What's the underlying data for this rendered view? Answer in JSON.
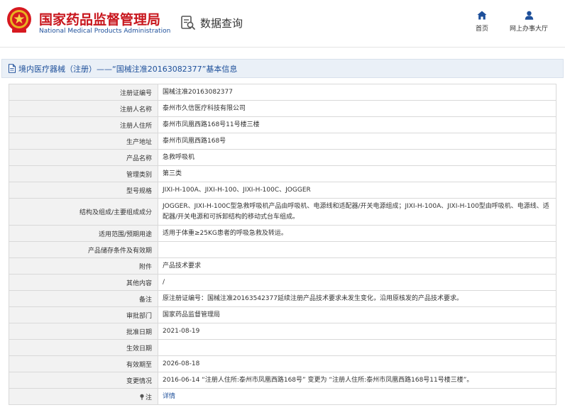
{
  "header": {
    "org_name_cn": "国家药品监督管理局",
    "org_name_en": "National Medical Products Administration",
    "query_label": "数据查询",
    "nav": [
      {
        "label": "首页",
        "icon": "home-icon"
      },
      {
        "label": "网上办事大厅",
        "icon": "user-icon"
      }
    ]
  },
  "title_bar": {
    "text": "境内医疗器械（注册）——“国械注准20163082377”基本信息",
    "icon": "document-icon"
  },
  "rows": [
    {
      "label": "注册证编号",
      "value": "国械注准20163082377"
    },
    {
      "label": "注册人名称",
      "value": "泰州市久信医疗科技有限公司"
    },
    {
      "label": "注册人住所",
      "value": "泰州市凤凰西路168号11号楼三楼"
    },
    {
      "label": "生产地址",
      "value": "泰州市凤凰西路168号"
    },
    {
      "label": "产品名称",
      "value": "急救呼吸机"
    },
    {
      "label": "管理类别",
      "value": "第三类"
    },
    {
      "label": "型号规格",
      "value": "JIXI-H-100A、JIXI-H-100、JIXI-H-100C、JOGGER"
    },
    {
      "label": "结构及组成/主要组成成分",
      "value": "JOGGER、JIXI-H-100C型急救呼吸机产品由呼吸机、电源线和适配器/开关电源组成；JIXI-H-100A、JIXI-H-100型由呼吸机、电源线、适配器/开关电源和可拆卸结构的移动式台车组成。"
    },
    {
      "label": "适用范围/预期用途",
      "value": "适用于体重≥25KG患者的呼吸急救及转运。"
    },
    {
      "label": "产品储存条件及有效期",
      "value": ""
    },
    {
      "label": "附件",
      "value": "产品技术要求"
    },
    {
      "label": "其他内容",
      "value": "/"
    },
    {
      "label": "备注",
      "value": "原注册证编号：国械注准20163542377延续注册产品技术要求未发生变化，沿用原核发的产品技术要求。"
    },
    {
      "label": "审批部门",
      "value": "国家药品监督管理局"
    },
    {
      "label": "批准日期",
      "value": "2021-08-19"
    },
    {
      "label": "生效日期",
      "value": ""
    },
    {
      "label": "有效期至",
      "value": "2026-08-18"
    },
    {
      "label": "变更情况",
      "value": "2016-06-14 “注册人住所:泰州市凤凰西路168号” 变更为 “注册人住所:泰州市凤凰西路168号11号楼三楼”。"
    }
  ],
  "note_row": {
    "label": "注",
    "value": "详情",
    "icon": "pin-icon"
  },
  "colors": {
    "brand_red": "#c8161d",
    "brand_blue": "#1d4f9a",
    "title_bar_bg": "#eaf0f7",
    "label_bg": "#f2f2f2",
    "border": "#d9d9d9"
  }
}
